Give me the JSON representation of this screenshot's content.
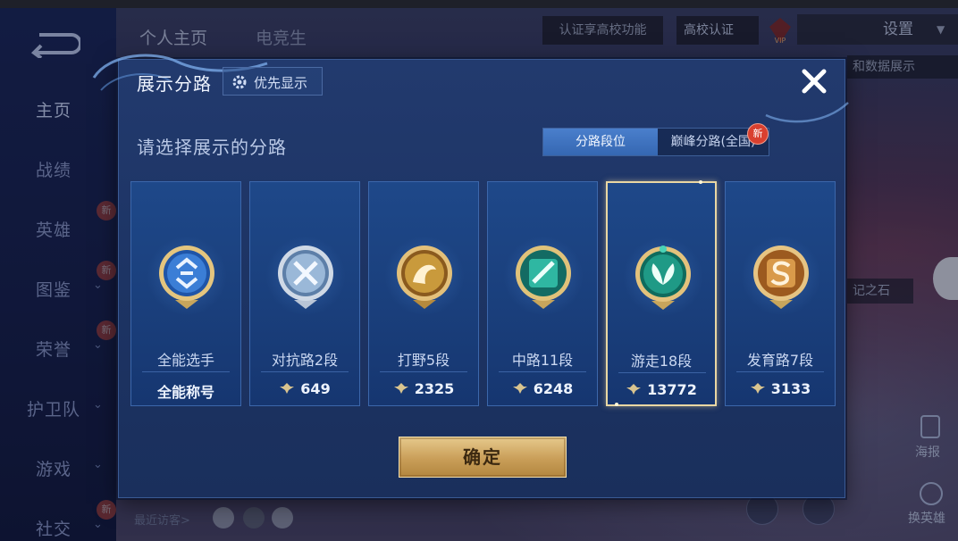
{
  "sidebar": {
    "items": [
      {
        "label": "主页",
        "chevron": false,
        "new": false,
        "active": true
      },
      {
        "label": "战绩",
        "chevron": false,
        "new": false,
        "active": false
      },
      {
        "label": "英雄",
        "chevron": false,
        "new": true,
        "active": false
      },
      {
        "label": "图鉴",
        "chevron": true,
        "new": true,
        "active": false
      },
      {
        "label": "荣誉",
        "chevron": true,
        "new": true,
        "active": false
      },
      {
        "label": "护卫队",
        "chevron": true,
        "new": false,
        "active": false
      },
      {
        "label": "游戏",
        "chevron": true,
        "new": false,
        "active": false
      },
      {
        "label": "社交",
        "chevron": true,
        "new": true,
        "active": false
      }
    ],
    "new_label": "新"
  },
  "background": {
    "tabs": [
      "个人主页",
      "电竞生"
    ],
    "cert_hint": "认证享高校功能",
    "cert_badge": "高校认证",
    "settings": "设置",
    "data_show": "和数据展示",
    "stone_text": "记之石",
    "poster": "海报",
    "swap_hero": "换英雄",
    "recent_visitors": "最近访客>"
  },
  "dialog": {
    "title": "展示分路",
    "priority_button": "优先显示",
    "subtitle": "请选择展示的分路",
    "segments": [
      {
        "label": "分路段位",
        "active": true
      },
      {
        "label": "巅峰分路(全国)",
        "active": false,
        "new": "新"
      }
    ],
    "cards": [
      {
        "label": "全能选手",
        "value": "全能称号",
        "has_points": false,
        "selected": false,
        "emblem": "all-round-emblem-icon",
        "color": "#3b7ed6"
      },
      {
        "label": "对抗路2段",
        "value": "649",
        "has_points": true,
        "selected": false,
        "emblem": "clash-lane-emblem-icon",
        "color": "#9ab8d8"
      },
      {
        "label": "打野5段",
        "value": "2325",
        "has_points": true,
        "selected": false,
        "emblem": "jungle-emblem-icon",
        "color": "#c99a3c"
      },
      {
        "label": "中路11段",
        "value": "6248",
        "has_points": true,
        "selected": false,
        "emblem": "mid-lane-emblem-icon",
        "color": "#2fb7a2"
      },
      {
        "label": "游走18段",
        "value": "13772",
        "has_points": true,
        "selected": true,
        "emblem": "roam-emblem-icon",
        "color": "#1f9a86"
      },
      {
        "label": "发育路7段",
        "value": "3133",
        "has_points": true,
        "selected": false,
        "emblem": "farm-lane-emblem-icon",
        "color": "#d99a4a"
      }
    ],
    "confirm_button": "确定"
  }
}
